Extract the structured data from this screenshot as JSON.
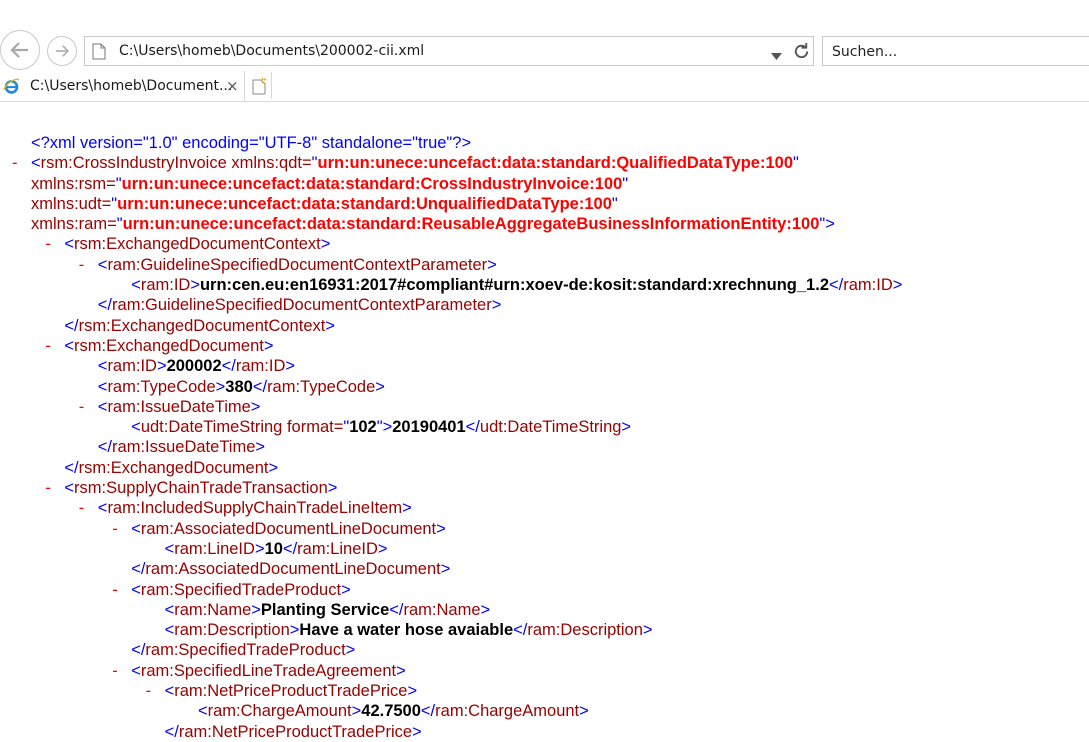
{
  "browser": {
    "address": "C:\\Users\\homeb\\Documents\\200002-cii.xml",
    "search_placeholder": "Suchen...",
    "tab_title": "C:\\Users\\homeb\\Document...",
    "tab_close": "×"
  },
  "icons": {
    "back": "back-arrow-icon",
    "forward": "forward-arrow-icon",
    "page": "page-icon",
    "dropdown": "dropdown-arrow-icon",
    "refresh": "refresh-icon",
    "ie": "internet-explorer-icon",
    "new_tab": "new-tab-icon"
  },
  "colors": {
    "markup": "#0000ff",
    "tag_name": "#990000",
    "attr_value": "#ff0000",
    "text": "#000000",
    "collapse_toggle": "#ff0000"
  },
  "xml": {
    "lines": [
      {
        "indent": 0,
        "toggle": false,
        "parts": [
          [
            "pi",
            "<?xml version=\"1.0\" encoding=\"UTF-8\" standalone=\"true\"?>"
          ]
        ]
      },
      {
        "indent": 0,
        "toggle": true,
        "parts": [
          [
            "b",
            "<"
          ],
          [
            "t",
            "rsm:CrossIndustryInvoice"
          ],
          [
            "an",
            " xmlns:qdt="
          ],
          [
            "b",
            "\""
          ],
          [
            "av",
            "urn:un:unece:uncefact:data:standard:QualifiedDataType:100"
          ],
          [
            "b",
            "\""
          ]
        ]
      },
      {
        "indent": 0,
        "toggle": false,
        "parts": [
          [
            "an",
            "xmlns:rsm="
          ],
          [
            "b",
            "\""
          ],
          [
            "av",
            "urn:un:unece:uncefact:data:standard:CrossIndustryInvoice:100"
          ],
          [
            "b",
            "\""
          ]
        ]
      },
      {
        "indent": 0,
        "toggle": false,
        "parts": [
          [
            "an",
            "xmlns:udt="
          ],
          [
            "b",
            "\""
          ],
          [
            "av",
            "urn:un:unece:uncefact:data:standard:UnqualifiedDataType:100"
          ],
          [
            "b",
            "\""
          ]
        ]
      },
      {
        "indent": 0,
        "toggle": false,
        "parts": [
          [
            "an",
            "xmlns:ram="
          ],
          [
            "b",
            "\""
          ],
          [
            "av",
            "urn:un:unece:uncefact:data:standard:ReusableAggregateBusinessInformationEntity:100"
          ],
          [
            "b",
            "\">"
          ]
        ]
      },
      {
        "indent": 1,
        "toggle": true,
        "parts": [
          [
            "b",
            "<"
          ],
          [
            "t",
            "rsm:ExchangedDocumentContext"
          ],
          [
            "b",
            ">"
          ]
        ]
      },
      {
        "indent": 2,
        "toggle": true,
        "parts": [
          [
            "b",
            "<"
          ],
          [
            "t",
            "ram:GuidelineSpecifiedDocumentContextParameter"
          ],
          [
            "b",
            ">"
          ]
        ]
      },
      {
        "indent": 3,
        "toggle": false,
        "parts": [
          [
            "b",
            "<"
          ],
          [
            "t",
            "ram:ID"
          ],
          [
            "b",
            ">"
          ],
          [
            "tx",
            "urn:cen.eu:en16931:2017#compliant#urn:xoev-de:kosit:standard:xrechnung_1.2"
          ],
          [
            "b",
            "</"
          ],
          [
            "t",
            "ram:ID"
          ],
          [
            "b",
            ">"
          ]
        ]
      },
      {
        "indent": 2,
        "toggle": false,
        "parts": [
          [
            "b",
            "</"
          ],
          [
            "t",
            "ram:GuidelineSpecifiedDocumentContextParameter"
          ],
          [
            "b",
            ">"
          ]
        ]
      },
      {
        "indent": 1,
        "toggle": false,
        "parts": [
          [
            "b",
            "</"
          ],
          [
            "t",
            "rsm:ExchangedDocumentContext"
          ],
          [
            "b",
            ">"
          ]
        ]
      },
      {
        "indent": 1,
        "toggle": true,
        "parts": [
          [
            "b",
            "<"
          ],
          [
            "t",
            "rsm:ExchangedDocument"
          ],
          [
            "b",
            ">"
          ]
        ]
      },
      {
        "indent": 2,
        "toggle": false,
        "parts": [
          [
            "b",
            "<"
          ],
          [
            "t",
            "ram:ID"
          ],
          [
            "b",
            ">"
          ],
          [
            "tx",
            "200002"
          ],
          [
            "b",
            "</"
          ],
          [
            "t",
            "ram:ID"
          ],
          [
            "b",
            ">"
          ]
        ]
      },
      {
        "indent": 2,
        "toggle": false,
        "parts": [
          [
            "b",
            "<"
          ],
          [
            "t",
            "ram:TypeCode"
          ],
          [
            "b",
            ">"
          ],
          [
            "tx",
            "380"
          ],
          [
            "b",
            "</"
          ],
          [
            "t",
            "ram:TypeCode"
          ],
          [
            "b",
            ">"
          ]
        ]
      },
      {
        "indent": 2,
        "toggle": true,
        "parts": [
          [
            "b",
            "<"
          ],
          [
            "t",
            "ram:IssueDateTime"
          ],
          [
            "b",
            ">"
          ]
        ]
      },
      {
        "indent": 3,
        "toggle": false,
        "parts": [
          [
            "b",
            "<"
          ],
          [
            "t",
            "udt:DateTimeString"
          ],
          [
            "an",
            " format="
          ],
          [
            "b",
            "\""
          ],
          [
            "tx",
            "102"
          ],
          [
            "b",
            "\">"
          ],
          [
            "tx",
            "20190401"
          ],
          [
            "b",
            "</"
          ],
          [
            "t",
            "udt:DateTimeString"
          ],
          [
            "b",
            ">"
          ]
        ]
      },
      {
        "indent": 2,
        "toggle": false,
        "parts": [
          [
            "b",
            "</"
          ],
          [
            "t",
            "ram:IssueDateTime"
          ],
          [
            "b",
            ">"
          ]
        ]
      },
      {
        "indent": 1,
        "toggle": false,
        "parts": [
          [
            "b",
            "</"
          ],
          [
            "t",
            "rsm:ExchangedDocument"
          ],
          [
            "b",
            ">"
          ]
        ]
      },
      {
        "indent": 1,
        "toggle": true,
        "parts": [
          [
            "b",
            "<"
          ],
          [
            "t",
            "rsm:SupplyChainTradeTransaction"
          ],
          [
            "b",
            ">"
          ]
        ]
      },
      {
        "indent": 2,
        "toggle": true,
        "parts": [
          [
            "b",
            "<"
          ],
          [
            "t",
            "ram:IncludedSupplyChainTradeLineItem"
          ],
          [
            "b",
            ">"
          ]
        ]
      },
      {
        "indent": 3,
        "toggle": true,
        "parts": [
          [
            "b",
            "<"
          ],
          [
            "t",
            "ram:AssociatedDocumentLineDocument"
          ],
          [
            "b",
            ">"
          ]
        ]
      },
      {
        "indent": 4,
        "toggle": false,
        "parts": [
          [
            "b",
            "<"
          ],
          [
            "t",
            "ram:LineID"
          ],
          [
            "b",
            ">"
          ],
          [
            "tx",
            "10"
          ],
          [
            "b",
            "</"
          ],
          [
            "t",
            "ram:LineID"
          ],
          [
            "b",
            ">"
          ]
        ]
      },
      {
        "indent": 3,
        "toggle": false,
        "parts": [
          [
            "b",
            "</"
          ],
          [
            "t",
            "ram:AssociatedDocumentLineDocument"
          ],
          [
            "b",
            ">"
          ]
        ]
      },
      {
        "indent": 3,
        "toggle": true,
        "parts": [
          [
            "b",
            "<"
          ],
          [
            "t",
            "ram:SpecifiedTradeProduct"
          ],
          [
            "b",
            ">"
          ]
        ]
      },
      {
        "indent": 4,
        "toggle": false,
        "parts": [
          [
            "b",
            "<"
          ],
          [
            "t",
            "ram:Name"
          ],
          [
            "b",
            ">"
          ],
          [
            "tx",
            "Planting Service"
          ],
          [
            "b",
            "</"
          ],
          [
            "t",
            "ram:Name"
          ],
          [
            "b",
            ">"
          ]
        ]
      },
      {
        "indent": 4,
        "toggle": false,
        "parts": [
          [
            "b",
            "<"
          ],
          [
            "t",
            "ram:Description"
          ],
          [
            "b",
            ">"
          ],
          [
            "tx",
            "Have a water hose avaiable"
          ],
          [
            "b",
            "</"
          ],
          [
            "t",
            "ram:Description"
          ],
          [
            "b",
            ">"
          ]
        ]
      },
      {
        "indent": 3,
        "toggle": false,
        "parts": [
          [
            "b",
            "</"
          ],
          [
            "t",
            "ram:SpecifiedTradeProduct"
          ],
          [
            "b",
            ">"
          ]
        ]
      },
      {
        "indent": 3,
        "toggle": true,
        "parts": [
          [
            "b",
            "<"
          ],
          [
            "t",
            "ram:SpecifiedLineTradeAgreement"
          ],
          [
            "b",
            ">"
          ]
        ]
      },
      {
        "indent": 4,
        "toggle": true,
        "parts": [
          [
            "b",
            "<"
          ],
          [
            "t",
            "ram:NetPriceProductTradePrice"
          ],
          [
            "b",
            ">"
          ]
        ]
      },
      {
        "indent": 5,
        "toggle": false,
        "parts": [
          [
            "b",
            "<"
          ],
          [
            "t",
            "ram:ChargeAmount"
          ],
          [
            "b",
            ">"
          ],
          [
            "tx",
            "42.7500"
          ],
          [
            "b",
            "</"
          ],
          [
            "t",
            "ram:ChargeAmount"
          ],
          [
            "b",
            ">"
          ]
        ]
      },
      {
        "indent": 4,
        "toggle": false,
        "parts": [
          [
            "b",
            "</"
          ],
          [
            "t",
            "ram:NetPriceProductTradePrice"
          ],
          [
            "b",
            ">"
          ]
        ]
      }
    ]
  }
}
